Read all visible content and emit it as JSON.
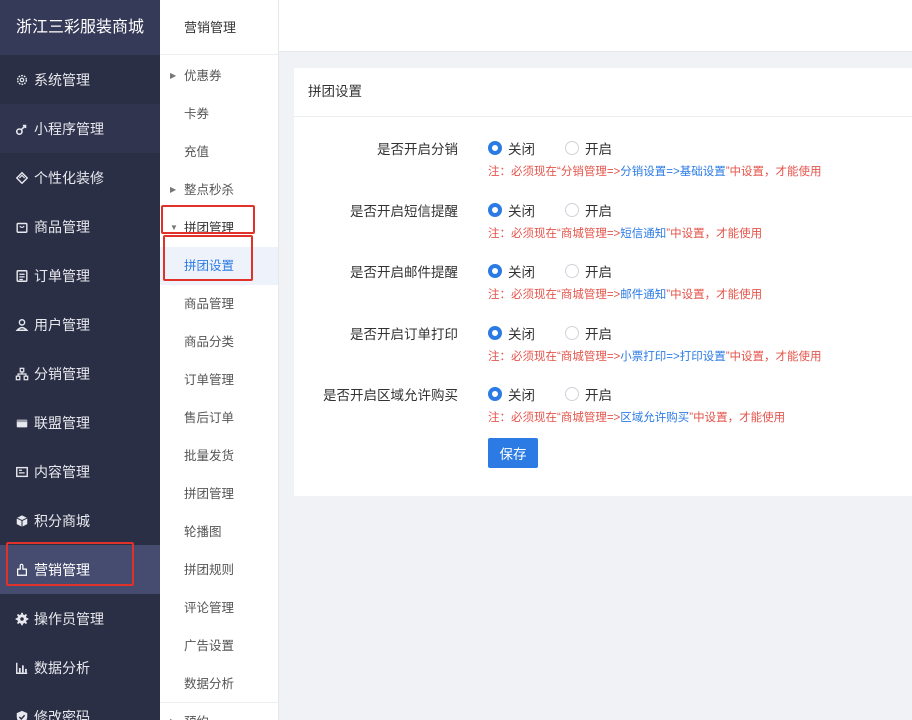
{
  "brand": "浙江三彩服装商城",
  "sidebar": {
    "items": [
      {
        "label": "系统管理",
        "icon": "gear-icon"
      },
      {
        "label": "小程序管理",
        "icon": "link-icon"
      },
      {
        "label": "个性化装修",
        "icon": "paint-icon"
      },
      {
        "label": "商品管理",
        "icon": "bag-icon"
      },
      {
        "label": "订单管理",
        "icon": "list-icon"
      },
      {
        "label": "用户管理",
        "icon": "user-icon"
      },
      {
        "label": "分销管理",
        "icon": "hierarchy-icon"
      },
      {
        "label": "联盟管理",
        "icon": "store-icon"
      },
      {
        "label": "内容管理",
        "icon": "doc-icon"
      },
      {
        "label": "积分商城",
        "icon": "cube-icon"
      },
      {
        "label": "营销管理",
        "icon": "hand-icon"
      },
      {
        "label": "操作员管理",
        "icon": "cog-icon"
      },
      {
        "label": "数据分析",
        "icon": "chart-icon"
      },
      {
        "label": "修改密码",
        "icon": "shield-icon"
      }
    ]
  },
  "submenu": {
    "title": "营销管理",
    "items": [
      {
        "label": "优惠券"
      },
      {
        "label": "卡券"
      },
      {
        "label": "充值"
      },
      {
        "label": "整点秒杀"
      },
      {
        "label": "拼团管理"
      },
      {
        "label": "拼团设置"
      },
      {
        "label": "商品管理"
      },
      {
        "label": "商品分类"
      },
      {
        "label": "订单管理"
      },
      {
        "label": "售后订单"
      },
      {
        "label": "批量发货"
      },
      {
        "label": "拼团管理"
      },
      {
        "label": "轮播图"
      },
      {
        "label": "拼团规则"
      },
      {
        "label": "评论管理"
      },
      {
        "label": "广告设置"
      },
      {
        "label": "数据分析"
      },
      {
        "label": "预约"
      }
    ]
  },
  "panel": {
    "title": "拼团设置",
    "off_label": "关闭",
    "on_label": "开启",
    "save_label": "保存",
    "rows": [
      {
        "label": "是否开启分销",
        "selected": "关闭",
        "note_prefix": "注：必须现在“分销管理=>",
        "note_link": "分销设置=>基础设置",
        "note_suffix": "”中设置，才能使用"
      },
      {
        "label": "是否开启短信提醒",
        "selected": "关闭",
        "note_prefix": "注：必须现在“商城管理=>",
        "note_link": "短信通知",
        "note_suffix": "”中设置，才能使用"
      },
      {
        "label": "是否开启邮件提醒",
        "selected": "关闭",
        "note_prefix": "注：必须现在“商城管理=>",
        "note_link": "邮件通知",
        "note_suffix": "”中设置，才能使用"
      },
      {
        "label": "是否开启订单打印",
        "selected": "关闭",
        "note_prefix": "注：必须现在“商城管理=>",
        "note_link": "小票打印=>打印设置",
        "note_suffix": "”中设置，才能使用"
      },
      {
        "label": "是否开启区域允许购买",
        "selected": "关闭",
        "note_prefix": "注：必须现在“商城管理=>",
        "note_link": "区域允许购买",
        "note_suffix": "”中设置，才能使用"
      }
    ]
  },
  "colors": {
    "accent": "#2c7be5",
    "warning": "#e4544b",
    "sidebar_bg": "#2b2f45",
    "highlight": "#e0312a"
  }
}
